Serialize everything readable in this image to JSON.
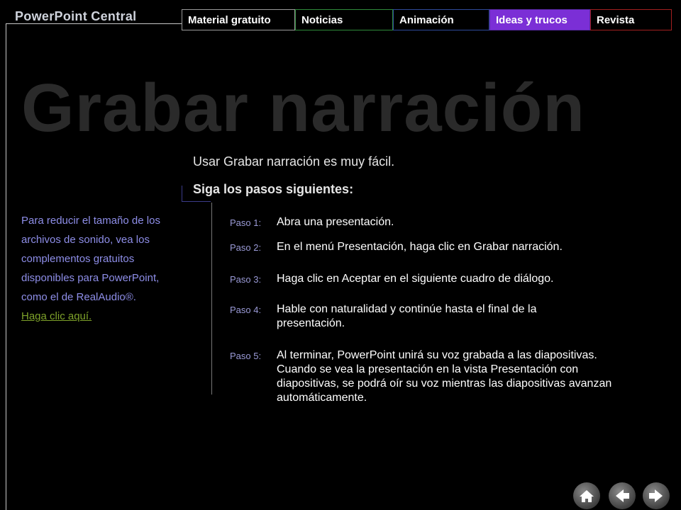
{
  "brand": "PowerPoint Central",
  "nav": [
    "Material gratuito",
    "Noticias",
    "Animación",
    "Ideas y trucos",
    "Revista"
  ],
  "watermark": "Grabar narración",
  "intro": "Usar Grabar narración es muy fácil.",
  "subhead": "Siga los pasos siguientes:",
  "sidebar": {
    "text": "Para reducir el tamaño de los archivos de sonido, vea los complementos gratuitos disponibles para PowerPoint, como el de RealAudio®.",
    "link": "Haga clic aquí."
  },
  "steps": [
    {
      "label": "Paso 1:",
      "text": "Abra una presentación."
    },
    {
      "label": "Paso 2:",
      "text": "En el menú Presentación, haga clic en Grabar narración."
    },
    {
      "label": "Paso 3:",
      "text": "Haga clic en Aceptar en el siguiente cuadro de diálogo."
    },
    {
      "label": "Paso 4:",
      "text": "Hable con naturalidad y continúe hasta el final de la presentación."
    },
    {
      "label": "Paso 5:",
      "text": "Al terminar, PowerPoint unirá su voz grabada a las diapositivas. Cuando se vea la presentación en la vista Presentación con diapositivas, se podrá oír su voz mientras las diapositivas avanzan automáticamente."
    }
  ],
  "controls": {
    "home": "home-icon",
    "back": "arrow-left-icon",
    "forward": "arrow-right-icon"
  },
  "colors": {
    "active_tab": "#7b2fd6",
    "link": "#7ea22a",
    "sidebar_text": "#8e8ee8"
  }
}
